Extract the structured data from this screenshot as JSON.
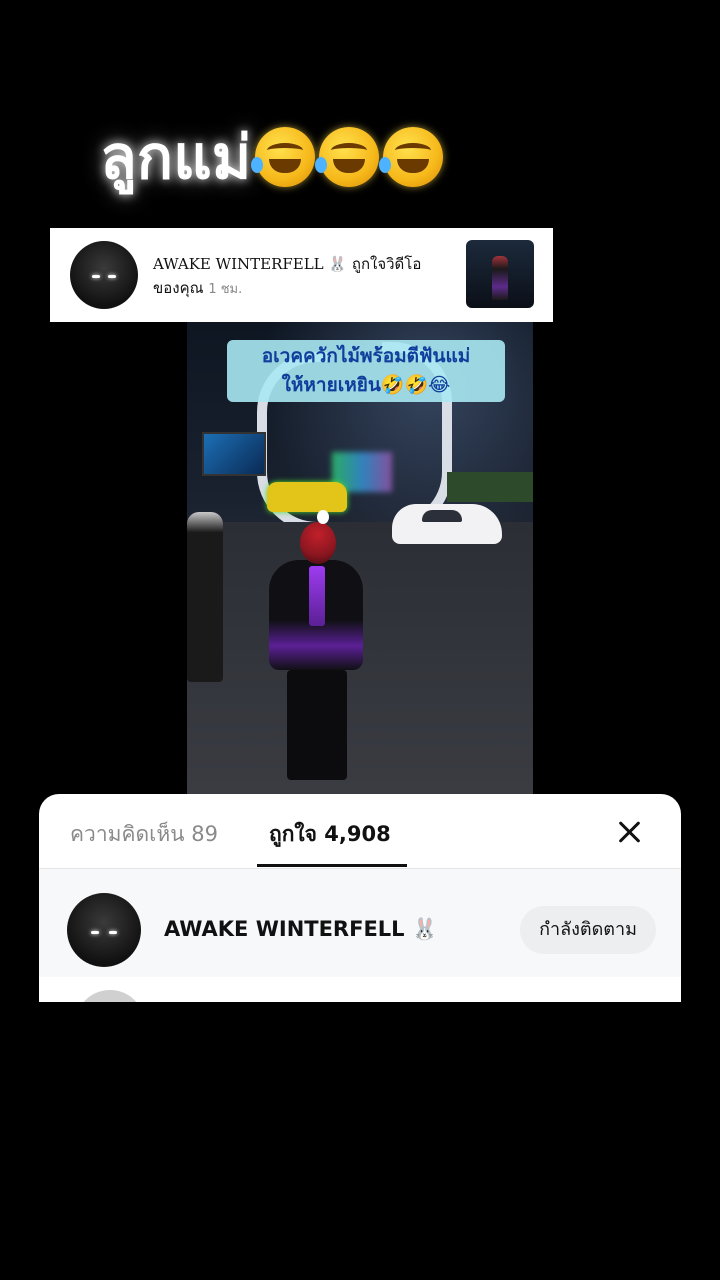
{
  "caption": {
    "text": "ลูกแม่",
    "emoji_name": "rolling-on-floor-laughing-emoji",
    "emoji_count": 3
  },
  "notification": {
    "line1": "AWAKE WINTERFELL 🐰 ถูกใจวิดีโอ",
    "line2": "ของคุณ",
    "time": "1 ชม."
  },
  "video": {
    "caption_line1": "อเวคควักไม้พร้อมตีฟันแม่",
    "caption_line2": "ให้หายเหยิน🤣🤣😂"
  },
  "sheet": {
    "tab_comments": "ความคิดเห็น 89",
    "tab_likes": "ถูกใจ 4,908",
    "active_tab": "likes",
    "user_name": "AWAKE WINTERFELL 🐰",
    "follow_label": "กำลังติดตาม"
  }
}
